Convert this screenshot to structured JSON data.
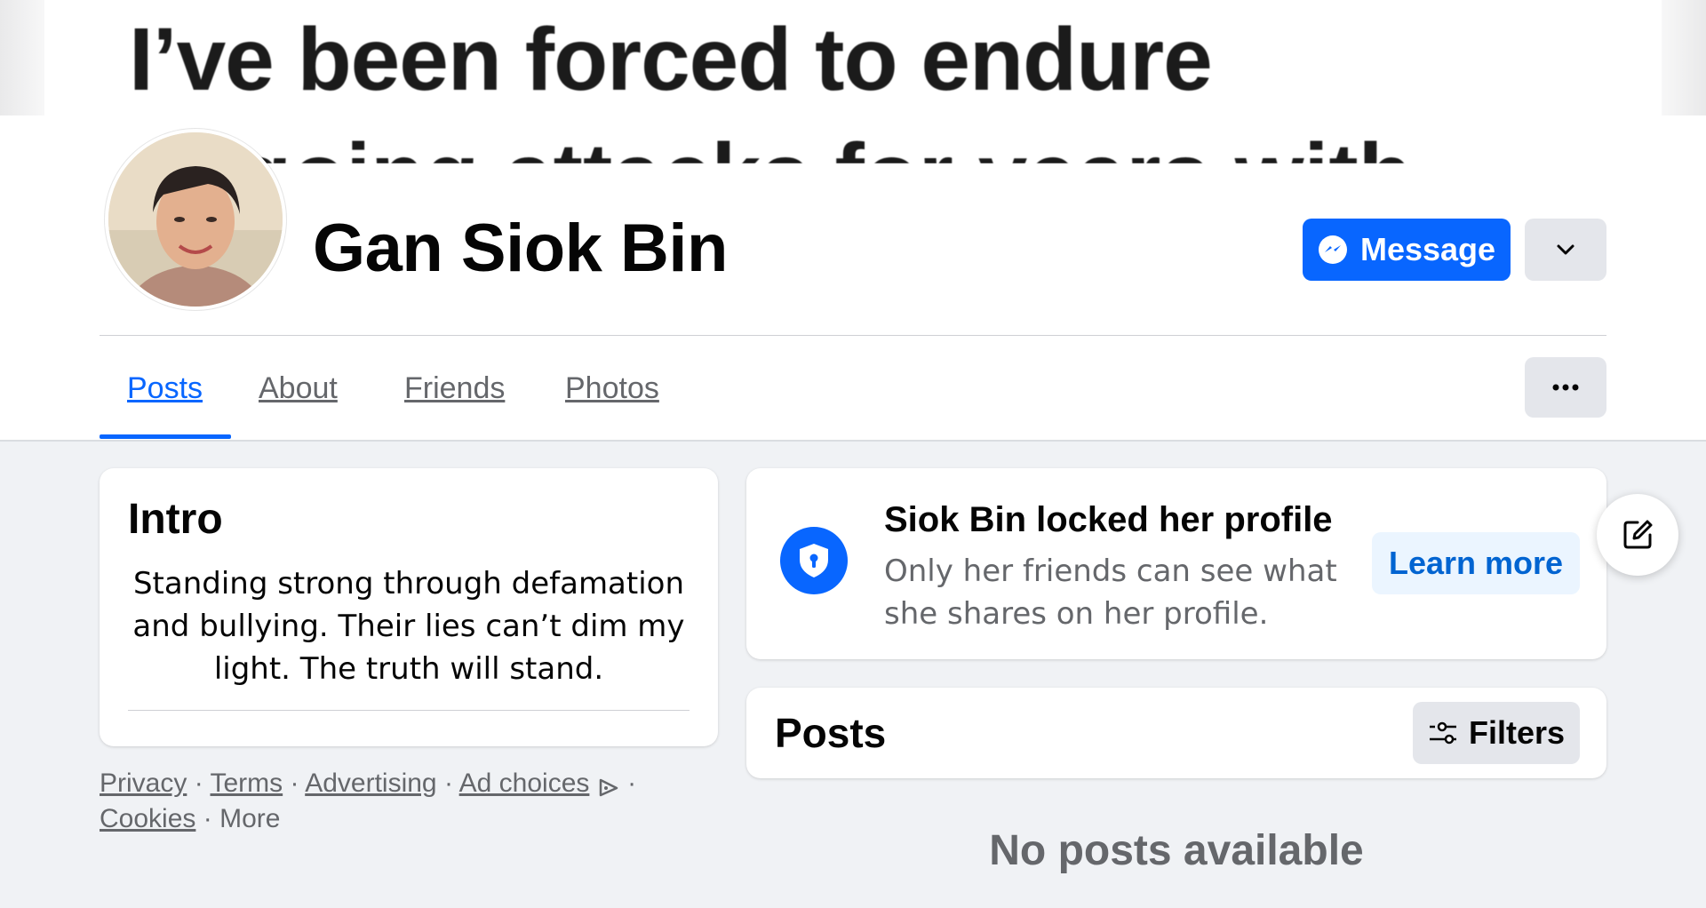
{
  "cover": {
    "line1": "I’ve been forced to endure",
    "line2": "ongoing attacks for years with"
  },
  "profile": {
    "name": "Gan Siok Bin",
    "message_label": "Message"
  },
  "tabs": [
    {
      "label": "Posts"
    },
    {
      "label": "About"
    },
    {
      "label": "Friends"
    },
    {
      "label": "Photos"
    }
  ],
  "intro": {
    "title": "Intro",
    "bio": "Standing strong through defamation and bullying. Their lies can’t dim my light. The truth will stand."
  },
  "footer": {
    "links": [
      "Privacy",
      "Terms",
      "Advertising",
      "Ad choices",
      "Cookies",
      "More"
    ],
    "separator": "·"
  },
  "locked": {
    "title": "Siok Bin locked her profile",
    "description": "Only her friends can see what she shares on her profile.",
    "learn_more": "Learn more"
  },
  "posts": {
    "title": "Posts",
    "filters_label": "Filters",
    "empty_text": "No posts available"
  },
  "colors": {
    "accent": "#0866ff",
    "background": "#f0f2f5",
    "secondary_text": "#65676b"
  }
}
